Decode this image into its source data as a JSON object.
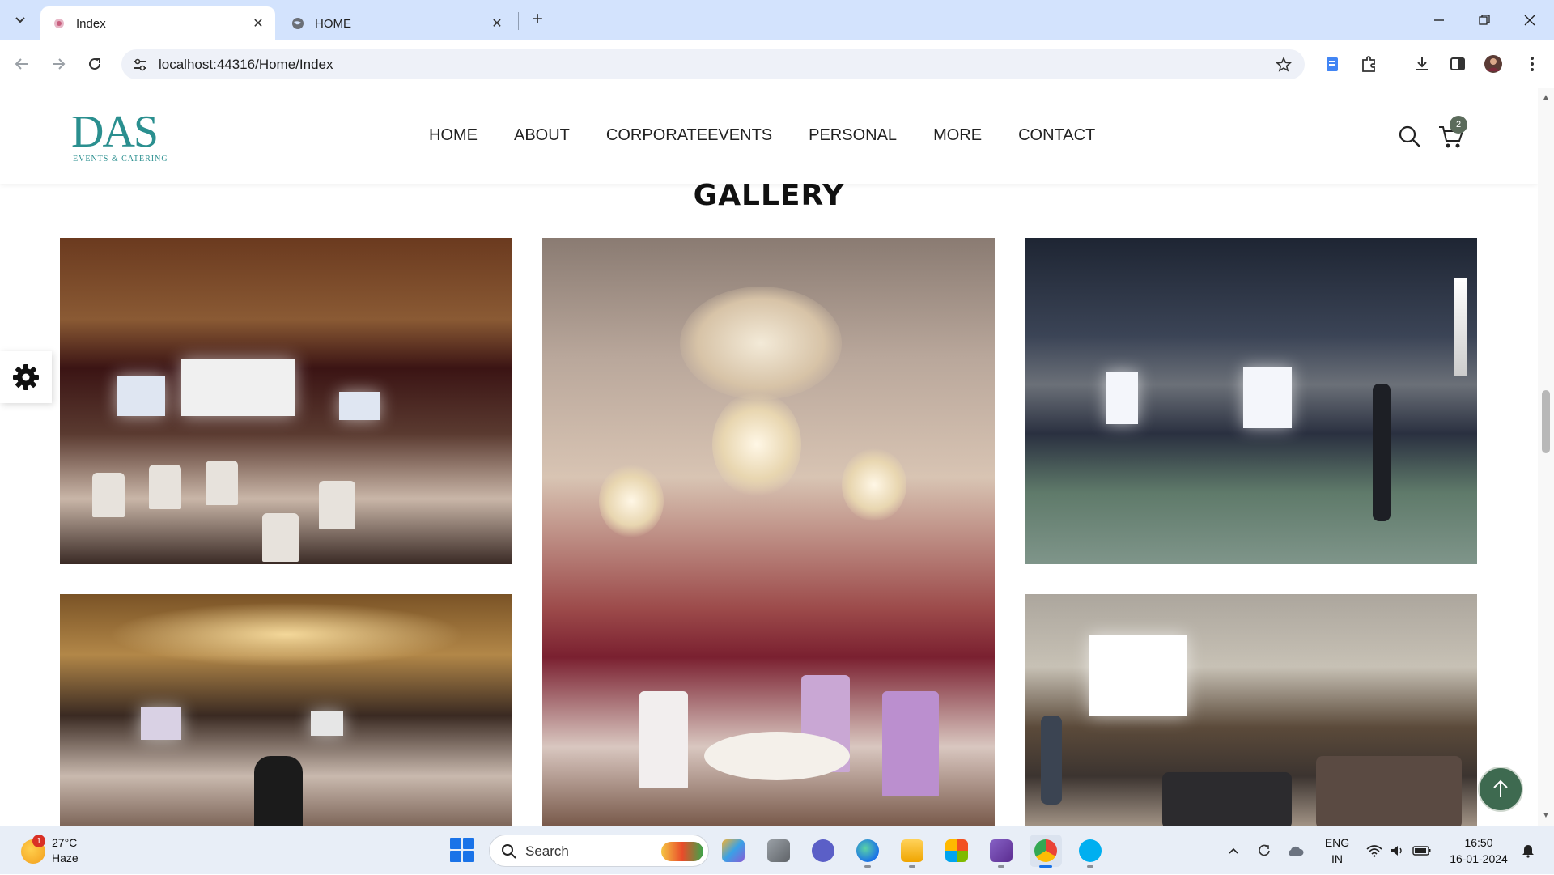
{
  "browser": {
    "tabs": [
      {
        "title": "Index",
        "active": true
      },
      {
        "title": "HOME",
        "active": false
      }
    ],
    "url": "localhost:44316/Home/Index"
  },
  "site": {
    "logo": {
      "mark": "DAS",
      "subtitle": "EVENTS & CATERING"
    },
    "nav": [
      "HOME",
      "ABOUT",
      "CORPORATEEVENTS",
      "PERSONAL",
      "MORE",
      "CONTACT"
    ],
    "cart_count": "2",
    "gallery_title": "GALLERY"
  },
  "colors": {
    "brand": "#2a8f8f",
    "to_top": "#3e6a50",
    "badge": "#5b6b5b"
  },
  "taskbar": {
    "weather": {
      "temp": "27°C",
      "condition": "Haze",
      "badge": "1"
    },
    "search_placeholder": "Search",
    "lang": {
      "line1": "ENG",
      "line2": "IN"
    },
    "time": "16:50",
    "date": "16-01-2024"
  }
}
